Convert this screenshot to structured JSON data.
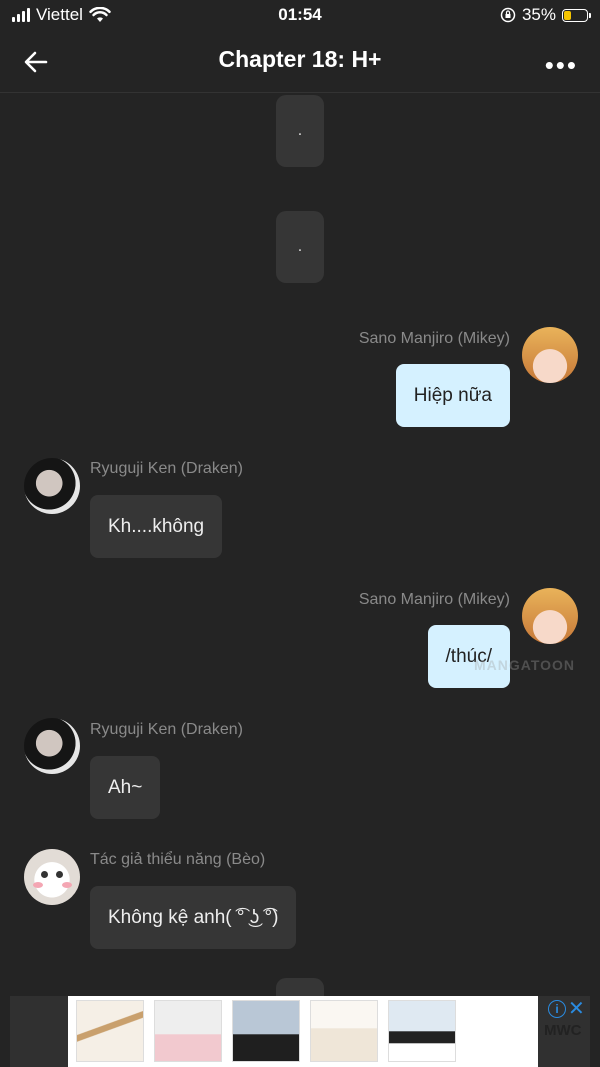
{
  "status": {
    "carrier": "Viettel",
    "time": "01:54",
    "battery": "35%",
    "battery_level": 0.35
  },
  "nav": {
    "title": "Chapter 18: H+"
  },
  "dots": [
    ".",
    " .",
    "."
  ],
  "messages": [
    {
      "name": "Sano Manjiro (Mikey)",
      "text": "Hiệp nữa"
    },
    {
      "name": "Ryuguji Ken (Draken)",
      "text": "Kh....không"
    },
    {
      "name": "Sano Manjiro (Mikey)",
      "text": "/thúc/"
    },
    {
      "name": "Ryuguji Ken (Draken)",
      "text": "Ah~"
    },
    {
      "name": "Tác giả thiểu năng (Bèo)",
      "text": "Không kệ anh( ͡° ͜ʖ ͡°)"
    }
  ],
  "watermark": "MANGATOON",
  "ad": {
    "brand": "MWC",
    "info": "i",
    "close": "✕"
  }
}
